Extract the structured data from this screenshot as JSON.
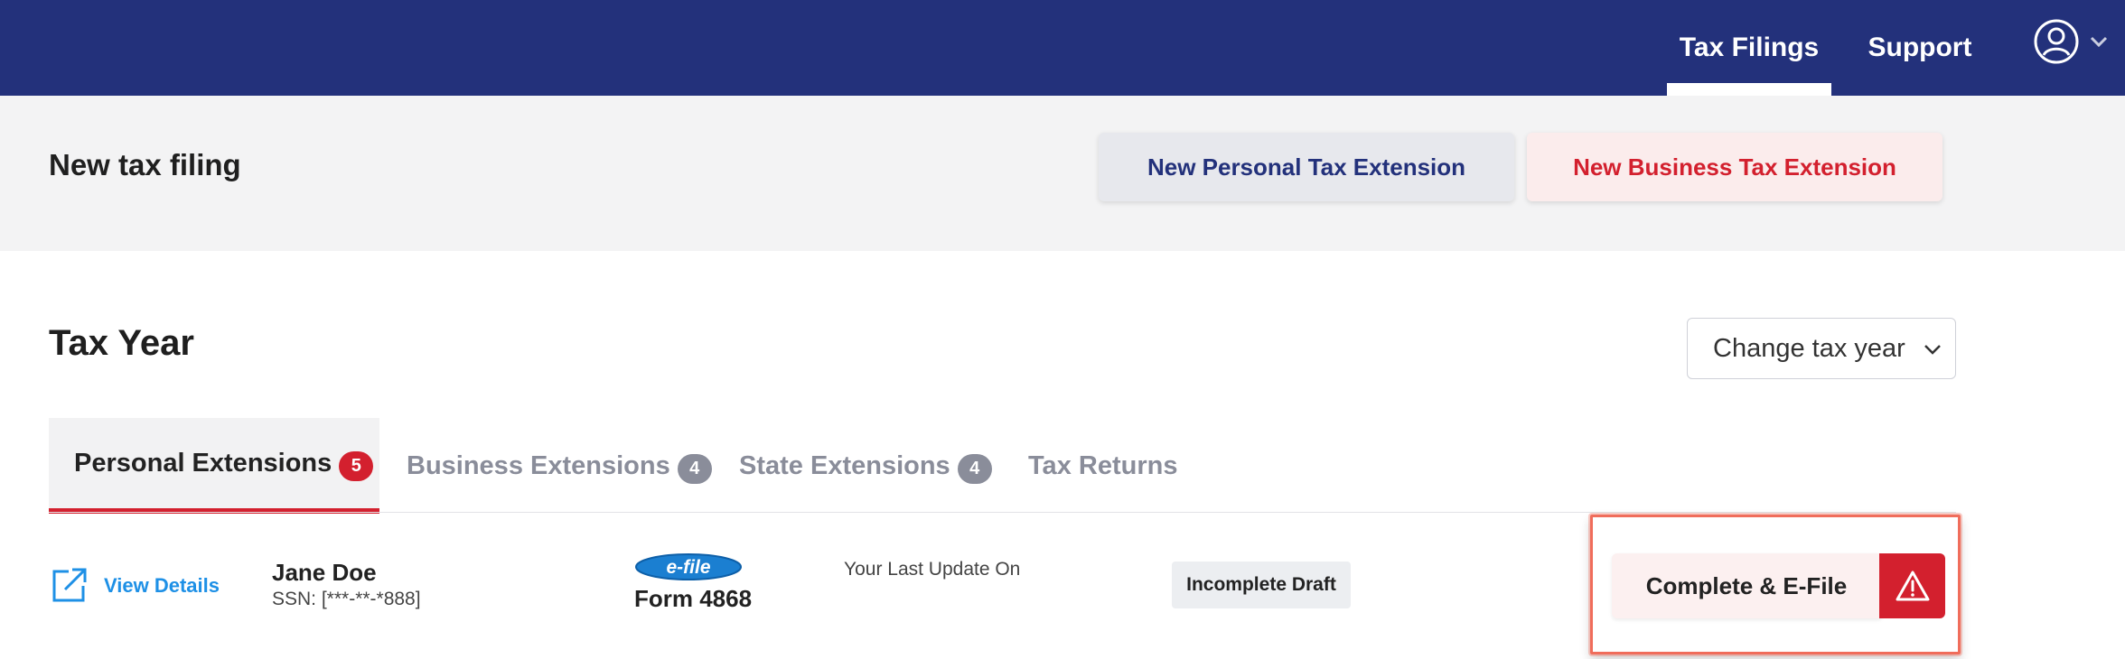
{
  "header": {
    "nav": [
      {
        "label": "Tax Filings",
        "active": true
      },
      {
        "label": "Support",
        "active": false
      }
    ],
    "user_icon": "user-circle-icon",
    "brand_color": "#23317b"
  },
  "new_filing": {
    "title": "New tax filing",
    "personal_button": "New Personal Tax Extension",
    "business_button": "New Business Tax Extension"
  },
  "tax_year": {
    "title": "Tax Year",
    "select_label": "Change tax year"
  },
  "tabs": [
    {
      "label": "Personal Extensions",
      "count": "5",
      "active": true
    },
    {
      "label": "Business Extensions",
      "count": "4",
      "active": false
    },
    {
      "label": "State Extensions",
      "count": "4",
      "active": false
    },
    {
      "label": "Tax Returns",
      "count": "",
      "active": false
    }
  ],
  "filing_row": {
    "view_details": "View Details",
    "name": "Jane Doe",
    "ssn": "SSN: [***-**-*888]",
    "efile_logo": "e-file",
    "form": "Form 4868",
    "last_update_label": "Your Last Update On",
    "status": "Incomplete Draft",
    "action_button": "Complete & E-File",
    "warning_icon": "warning-icon",
    "accent_color": "#d3202e"
  }
}
